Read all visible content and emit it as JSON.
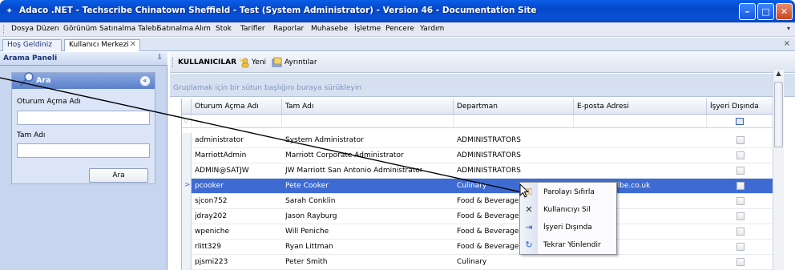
{
  "window": {
    "title": "Adaco .NET - Techscribe Chinatown Sheffield - Test (System Administrator) - Version 46 - Documentation Site",
    "minimize": "–",
    "maximize": "□",
    "close": "✕"
  },
  "menu": [
    "Dosya",
    "Düzen",
    "Görünüm",
    "Satınalma Talebi",
    "Satınalma",
    "Alım",
    "Stok",
    "Tarifler",
    "Raporlar",
    "Muhasebe",
    "İşletme",
    "Pencere",
    "Yardım"
  ],
  "doc_tabs": [
    {
      "label": "Hoş Geldiniz"
    },
    {
      "label": "Kullanıcı Merkezi",
      "close": "✕"
    }
  ],
  "left_panel": {
    "title": "Arama Paneli",
    "pin": "⇩",
    "box_title": "Ara",
    "collapse": "«",
    "field1_label": "Oturum Açma Adı",
    "field2_label": "Tam Adı",
    "search_button": "Ara"
  },
  "toolbar": {
    "title": "KULLANICILAR",
    "new_label": "Yeni",
    "details_label": "Ayrıntılar"
  },
  "group_hint": "Gruplamak için bir sütun başlığını buraya sürükleyin",
  "grid": {
    "columns": [
      "Oturum Açma Adı",
      "Tam Adı",
      "Departman",
      "E-posta Adresi",
      "İşyeri Dışında"
    ],
    "rows": [
      {
        "login": "administrator",
        "name": "System Administrator",
        "dept": "ADMINISTRATORS",
        "email": "",
        "out": false
      },
      {
        "login": "MarriottAdmin",
        "name": "Marriott Corporate Administrator",
        "dept": "ADMINISTRATORS",
        "email": "",
        "out": false
      },
      {
        "login": "ADMIN@SATJW",
        "name": "JW Marriott San Antonio Administrator",
        "dept": "ADMINISTRATORS",
        "email": "",
        "out": false
      },
      {
        "login": "pcooker",
        "name": "Pete Cooker",
        "dept": "Culinary",
        "email": "...@techscribe.co.uk",
        "out": false,
        "selected": true
      },
      {
        "login": "sjcon752",
        "name": "Sarah Conklin",
        "dept": "Food & Beverage",
        "email": "",
        "out": false
      },
      {
        "login": "jdray202",
        "name": "Jason Rayburg",
        "dept": "Food & Beverage",
        "email": "",
        "out": false
      },
      {
        "login": "wpeniche",
        "name": "Will Peniche",
        "dept": "Food & Beverage",
        "email": "",
        "out": false
      },
      {
        "login": "rlitt329",
        "name": "Ryan Littman",
        "dept": "Food & Beverage",
        "email": "",
        "out": false
      },
      {
        "login": "pjsmi223",
        "name": "Peter Smith",
        "dept": "Culinary",
        "email": "",
        "out": false
      }
    ]
  },
  "context_menu": [
    {
      "label": "Parolayı Sıfırla",
      "icon": "key-icon"
    },
    {
      "label": "Kullanıcıyı Sil",
      "icon": "delete-x-icon"
    },
    {
      "label": "İşyeri Dışında",
      "icon": "out-of-office-icon"
    },
    {
      "label": "Tekrar Yönlendir",
      "icon": "redirect-icon"
    }
  ],
  "colors": {
    "titlebar": "#0546c9",
    "selection": "#3d6bd2",
    "panel": "#c7d5ee"
  }
}
